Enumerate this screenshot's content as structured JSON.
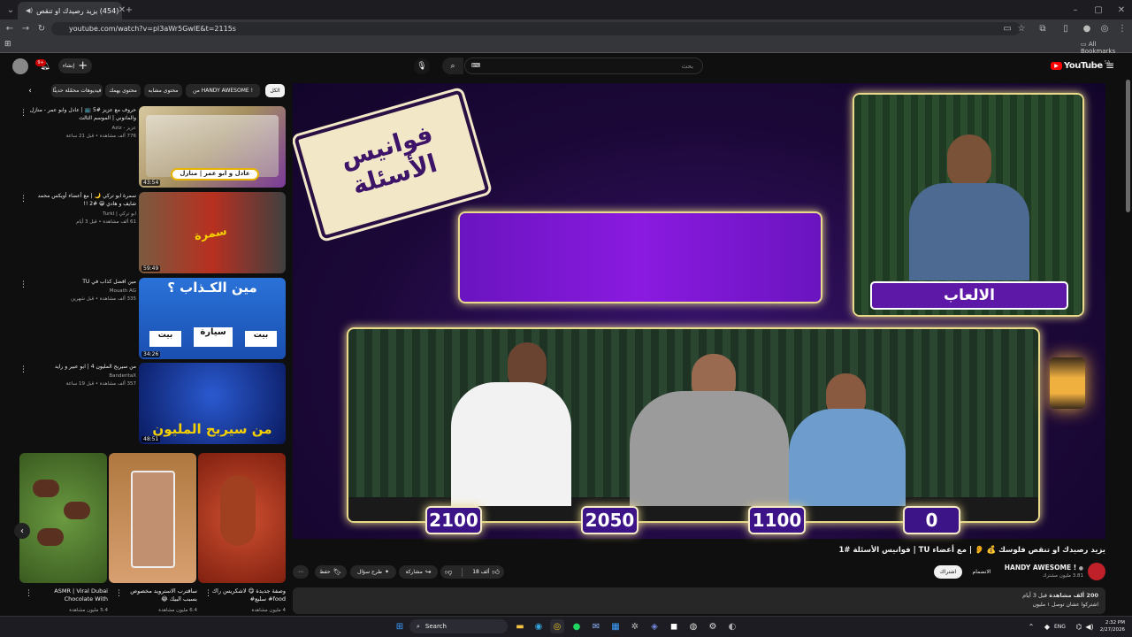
{
  "browser": {
    "tab_title": "(454) يزيد رصيدك او تنقص",
    "url": "youtube.com/watch?v=pl3aWr5GwIE&t=2115s",
    "all_bookmarks": "All Bookmarks"
  },
  "header": {
    "logo": "YouTube",
    "logo_country": "SA",
    "search_placeholder": "بحث",
    "create_label": "إنشاء",
    "notif_count": "9+"
  },
  "chips": [
    "الكل",
    "من HANDY AWESOME !",
    "محتوى مشابه",
    "محتوى يهمك",
    "فيديوهات محمّلة حديثًا"
  ],
  "sidebar_videos": [
    {
      "title": "حروف مع عزيز #5 📺 | عادل وابو عمر - منازل والمانوني | الموسم الثالث",
      "channel": "عزيز - Aziz",
      "meta": "776 ألف مشاهدة • قبل 21 ساعة",
      "duration": "43:54"
    },
    {
      "title": "سمرة ابو تركي 🌙 | مع أعضاء أويكس محمد شايف و هادي 😁 #2 !!",
      "channel": "ابو تركي | TurkI",
      "meta": "61 ألف مشاهدة • قبل 3 أيام",
      "duration": "59:49"
    },
    {
      "title": "مين افضل كذاب في TU",
      "channel": "Mouath AG",
      "meta": "335 ألف مشاهدة • قبل شهرين",
      "duration": "34:26"
    },
    {
      "title": "من سيربح المليون 4 | ابو عبير و رايد",
      "channel": "BanderitaX",
      "meta": "357 ألف مشاهدة • قبل 19 ساعة",
      "duration": "48:51"
    }
  ],
  "shorts": [
    {
      "title": "ASMR | Viral Dubai Chocolate With",
      "views": "5.4 مليون مشاهدة"
    },
    {
      "title": "ساقترب الاسترويد مخصوص بسبب البيك 😂",
      "views": "6.4 مليون مشاهدة"
    },
    {
      "title": "وصفة جديدة 😋 لاشكريس راك food# سلبع#",
      "views": "4 مليون مشاهدة"
    }
  ],
  "player": {
    "show_logo": "فوانيس الأسئلة",
    "player_name": "الالعاب",
    "scores": [
      "2100",
      "2050",
      "1100",
      "0"
    ]
  },
  "video": {
    "title": "يزيد رصيدك او تنقص فلوسك 💰 👂 | مع أعضاء TU | فوانيس الأسئلة #1",
    "channel": "HANDY AWESOME !",
    "subscribers": "3.81 مليون مشترك",
    "subscribe": "اشتراك",
    "join": "الانضمام",
    "likes": "18 ألف",
    "share": "مشاركة",
    "ask": "طرح سؤال",
    "save": "حفظ",
    "views": "200 ألف مشاهدة",
    "ago": "قبل 3 أيام",
    "desc": "اشتركوا عشان توصل ١ مليون"
  },
  "taskbar": {
    "search": "Search",
    "lang": "ENG",
    "time": "2:32 PM",
    "date": "2/27/2026"
  }
}
